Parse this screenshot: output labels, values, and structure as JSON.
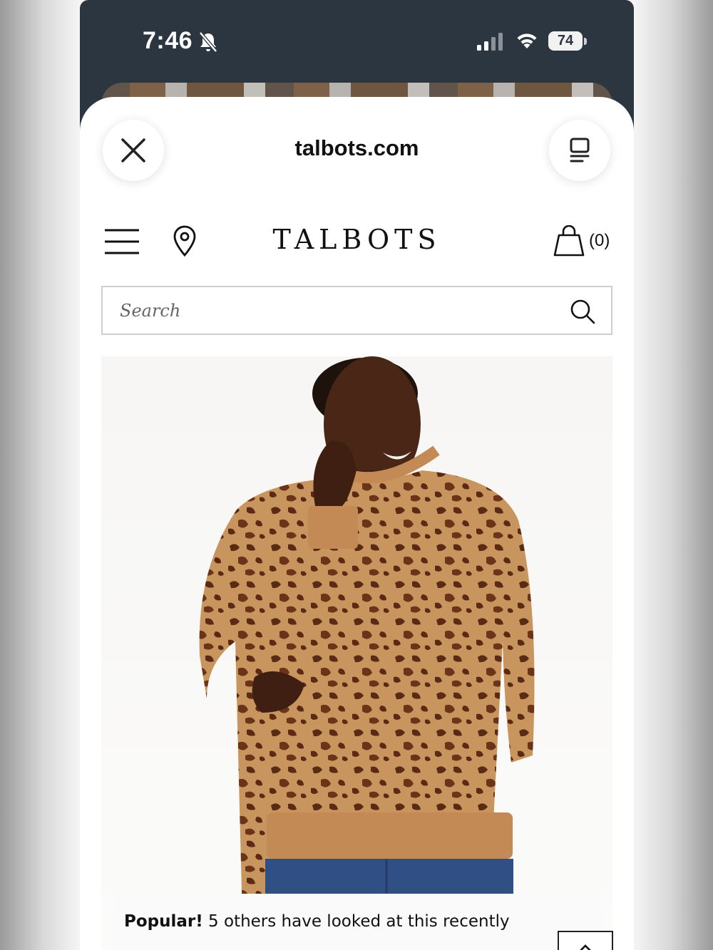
{
  "status_bar": {
    "time": "7:46",
    "battery": "74",
    "icons": [
      "bell-slash-icon",
      "signal-icon",
      "wifi-icon",
      "battery-icon"
    ]
  },
  "browser_sheet": {
    "domain": "talbots.com",
    "close_icon": "close-icon",
    "tabs_icon": "tabs-icon"
  },
  "site_header": {
    "logo": "TALBOTS",
    "cart_count": "(0)",
    "icons": [
      "menu-icon",
      "location-pin-icon",
      "shopping-bag-icon"
    ]
  },
  "search": {
    "placeholder": "Search",
    "icon": "search-icon"
  },
  "product": {
    "image": "woman wearing leopard print sweatshirt and jeans",
    "popular_label": "Popular!",
    "popular_text": "5 others have looked at this recently"
  },
  "colors": {
    "phone_frame": "#2c3640",
    "leopard_base": "#c9955e",
    "leopard_spots": "#5a2a14"
  }
}
